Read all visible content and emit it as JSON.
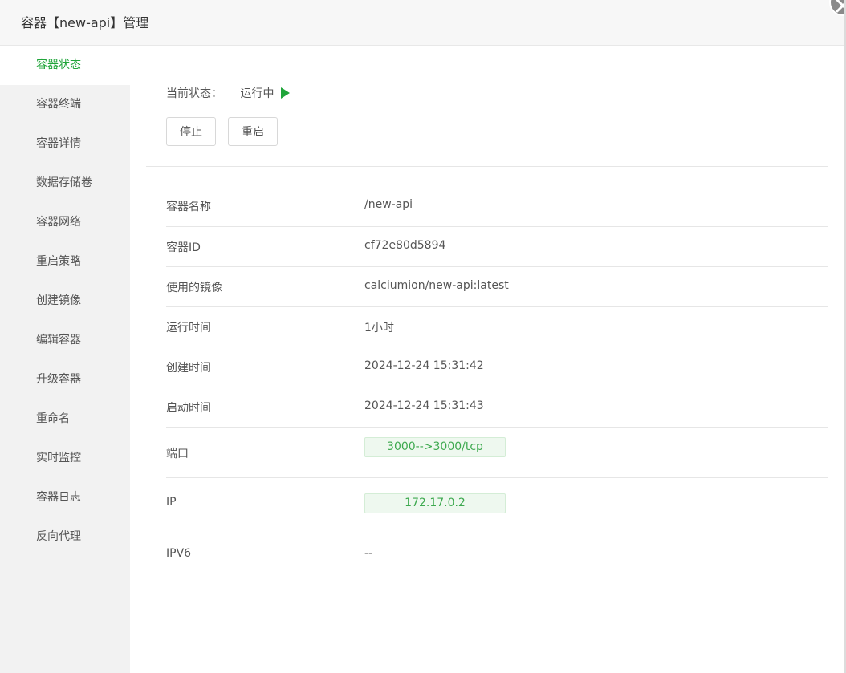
{
  "header": {
    "title": "容器【new-api】管理"
  },
  "sidebar": {
    "items": [
      {
        "label": "容器状态",
        "active": true
      },
      {
        "label": "容器终端"
      },
      {
        "label": "容器详情"
      },
      {
        "label": "数据存储卷"
      },
      {
        "label": "容器网络"
      },
      {
        "label": "重启策略"
      },
      {
        "label": "创建镜像"
      },
      {
        "label": "编辑容器"
      },
      {
        "label": "升级容器"
      },
      {
        "label": "重命名"
      },
      {
        "label": "实时监控"
      },
      {
        "label": "容器日志"
      },
      {
        "label": "反向代理"
      }
    ]
  },
  "status": {
    "label": "当前状态：",
    "value": "运行中",
    "icon": "play-icon"
  },
  "actions": {
    "stop_label": "停止",
    "restart_label": "重启"
  },
  "info": {
    "rows": [
      {
        "label": "容器名称",
        "value": "/new-api"
      },
      {
        "label": "容器ID",
        "value": "cf72e80d5894"
      },
      {
        "label": "使用的镜像",
        "value": "calciumion/new-api:latest"
      },
      {
        "label": "运行时间",
        "value": "1小时"
      },
      {
        "label": "创建时间",
        "value": "2024-12-24 15:31:42"
      },
      {
        "label": "启动时间",
        "value": "2024-12-24 15:31:43"
      },
      {
        "label": "端口",
        "value": "3000-->3000/tcp",
        "tag": true
      },
      {
        "label": "IP",
        "value": "172.17.0.2",
        "tag": true
      },
      {
        "label": "IPV6",
        "value": "--"
      }
    ]
  },
  "colors": {
    "accent": "#20a53a",
    "tag_text": "#3da94f",
    "tag_bg": "#eef8ef",
    "sidebar_bg": "#f2f2f2"
  }
}
